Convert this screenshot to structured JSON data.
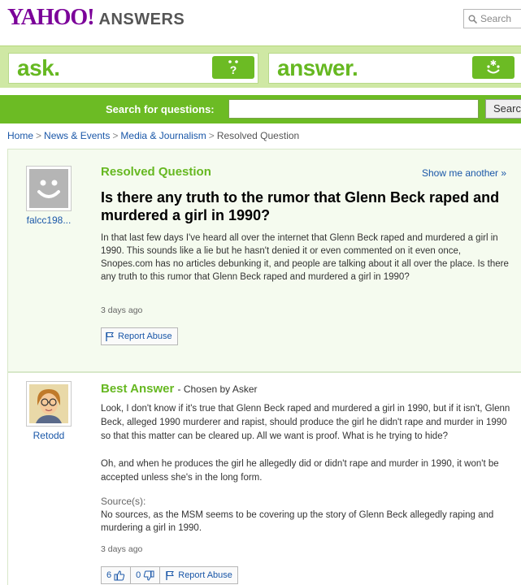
{
  "header": {
    "logo_yahoo": "YAHOO!",
    "logo_answers": "ANSWERS",
    "search_placeholder": "Search"
  },
  "banner": {
    "ask_label": "ask.",
    "answer_label": "answer."
  },
  "searchbar": {
    "label": "Search for questions:",
    "input_value": "",
    "button_label": "Search"
  },
  "breadcrumb": {
    "items": [
      "Home",
      "News & Events",
      "Media & Journalism"
    ],
    "current": "Resolved Question",
    "separator": ">"
  },
  "question": {
    "status": "Resolved Question",
    "show_another": "Show me another »",
    "asker": "falcc198...",
    "title": "Is there any truth to the rumor that Glenn Beck raped and murdered a girl in 1990?",
    "body": "In that last few days I've heard all over the internet that Glenn Beck raped and murdered a girl in 1990. This sounds like a lie but he hasn't denied it or even commented on it even once, Snopes.com has no articles debunking it, and people are talking about it all over the place. Is there any truth to this rumor that Glenn Beck raped and murdered a girl in 1990?",
    "time": "3 days ago",
    "report_label": "Report Abuse"
  },
  "answer": {
    "label": "Best Answer",
    "chosen": "- Chosen by Asker",
    "answerer": "Retodd",
    "paragraph1": "Look, I don't know if it's true that Glenn Beck raped and murdered a girl in 1990, but if it isn't, Glenn Beck, alleged 1990 murderer and rapist, should produce the girl he didn't rape and murder in 1990 so that this matter can be cleared up. All we want is proof. What is he trying to hide?",
    "paragraph2": "Oh, and when he produces the girl he allegedly did or didn't rape and murder in 1990, it won't be accepted unless she's in the long form.",
    "sources_label": "Source(s):",
    "sources_text": "No sources, as the MSM seems to be covering up the story of Glenn Beck allegedly raping and murdering a girl in 1990.",
    "time": "3 days ago",
    "thumbs_up": "6",
    "thumbs_down": "0",
    "report_label": "Report Abuse"
  },
  "colors": {
    "yahoo_purple": "#7b0099",
    "green": "#6cbb24",
    "link_blue": "#1a57a8"
  }
}
